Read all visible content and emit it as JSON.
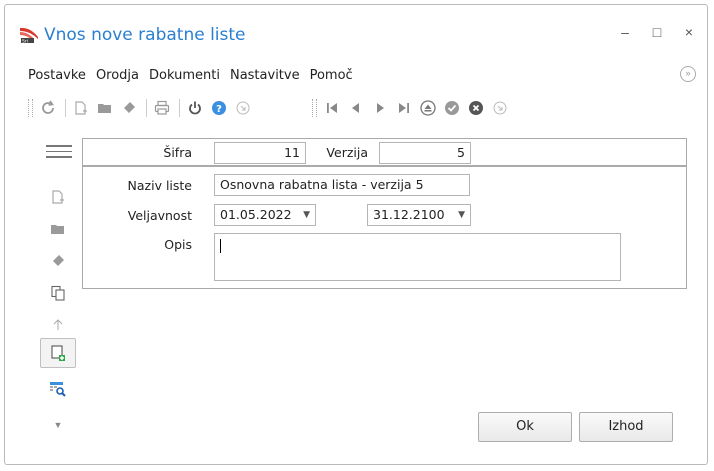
{
  "window": {
    "title": "Vnos nove rabatne liste",
    "controls": {
      "minimize": "–",
      "maximize": "□",
      "close": "×"
    }
  },
  "menu": {
    "items": [
      "Postavke",
      "Orodja",
      "Dokumenti",
      "Nastavitve",
      "Pomoč"
    ]
  },
  "toolbar": {
    "icons": [
      "refresh-icon",
      "new-icon",
      "open-folder-icon",
      "eraser-icon",
      "print-icon",
      "power-icon",
      "help-icon",
      "expand-icon",
      "first-record-icon",
      "prev-record-icon",
      "next-record-icon",
      "last-record-icon",
      "eject-icon",
      "confirm-icon",
      "cancel-icon",
      "expand-icon"
    ]
  },
  "sidebar": {
    "icons": [
      "menu-icon",
      "new-icon",
      "open-folder-icon",
      "eraser-icon",
      "copy-icon",
      "split-icon",
      "add-new-icon",
      "search-table-icon",
      "chevron-down-icon"
    ]
  },
  "form": {
    "sifra_label": "Šifra",
    "sifra_value": "11",
    "verzija_label": "Verzija",
    "verzija_value": "5",
    "naziv_label": "Naziv liste",
    "naziv_value": "Osnovna rabatna lista - verzija 5",
    "veljavnost_label": "Veljavnost",
    "veljavnost_from": "01.05.2022",
    "veljavnost_to": "31.12.2100",
    "opis_label": "Opis",
    "opis_value": ""
  },
  "buttons": {
    "ok": "Ok",
    "izhod": "Izhod"
  },
  "colors": {
    "title": "#2a7fd1",
    "accent_green": "#2da84a",
    "help_blue": "#3b8fe0"
  }
}
